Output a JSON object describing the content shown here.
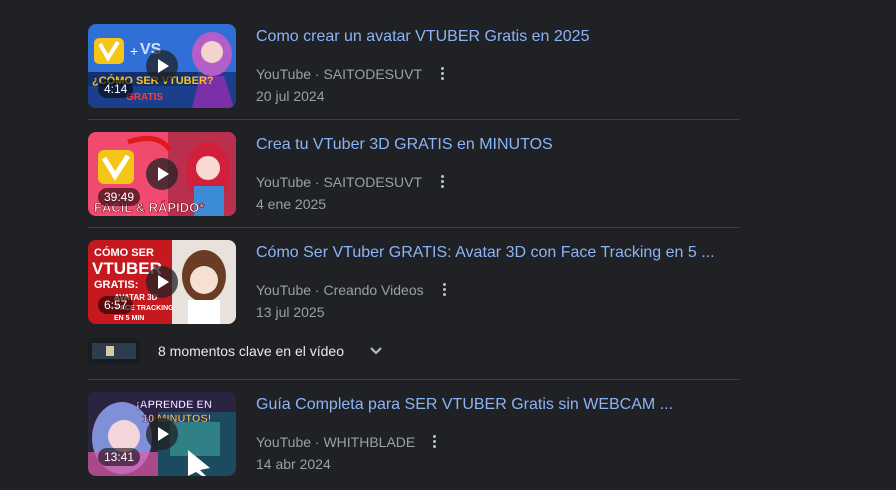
{
  "videos": [
    {
      "title": "Como crear un avatar VTUBER Gratis en 2025",
      "source": "YouTube",
      "channel": "SAITODESUVT",
      "date": "20 jul 2024",
      "duration": "4:14",
      "thumb_text": "¿CÓMO SER VTUBER?",
      "thumb_text2": "GRATIS"
    },
    {
      "title": "Crea tu VTuber 3D GRATIS en MINUTOS",
      "source": "YouTube",
      "channel": "SAITODESUVT",
      "date": "4 ene 2025",
      "duration": "39:49",
      "thumb_text": "FÁCIL & RÁPIDO*"
    },
    {
      "title": "Cómo Ser VTuber GRATIS: Avatar 3D con Face Tracking en 5 ...",
      "source": "YouTube",
      "channel": "Creando Videos",
      "date": "13 jul 2025",
      "duration": "6:57",
      "thumb_text": "CÓMO SER",
      "thumb_text2": "VTUBER",
      "thumb_text3": "GRATIS:",
      "thumb_text4": "AVATAR 3D",
      "thumb_text5": "+ FACE TRACKING",
      "thumb_text6": "EN 5 MIN"
    },
    {
      "title": "Guía Completa para SER VTUBER Gratis sin WEBCAM ...",
      "source": "YouTube",
      "channel": "WHITHBLADE",
      "date": "14 abr 2024",
      "duration": "13:41",
      "thumb_text": "¡APRENDE EN",
      "thumb_text2": "10 MINUTOS!"
    }
  ],
  "separator": "·",
  "key_moments": {
    "label": "8 momentos clave en el vídeo"
  },
  "colors": {
    "background": "#202124",
    "title_link": "#8ab4f8",
    "meta_text": "#9aa0a6",
    "divider": "#3c4043"
  },
  "icons": {
    "play": "play-icon",
    "more": "more-vert-icon",
    "expand": "chevron-down-icon"
  }
}
